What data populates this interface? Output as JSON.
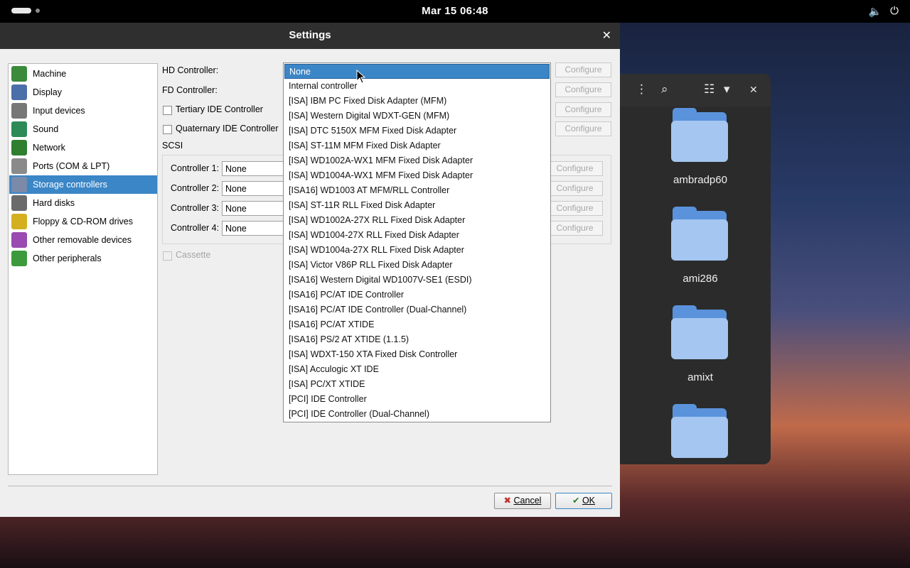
{
  "topbar": {
    "clock": "Mar 15  06:48",
    "volume_icon": "🔈",
    "power_icon": "⏻"
  },
  "files": {
    "header_icons": {
      "menu": "⋮",
      "search": "⌕",
      "view": "☷",
      "dropdown": "▾",
      "close": "✕"
    },
    "folders": [
      "ambradp60",
      "ami286",
      "amixt",
      ""
    ]
  },
  "dialog": {
    "title": "Settings",
    "close": "✕",
    "categories": [
      {
        "label": "Machine",
        "color": "#3c8a3c"
      },
      {
        "label": "Display",
        "color": "#4b6fa8"
      },
      {
        "label": "Input devices",
        "color": "#777777"
      },
      {
        "label": "Sound",
        "color": "#2e8b57"
      },
      {
        "label": "Network",
        "color": "#2f7f2f"
      },
      {
        "label": "Ports (COM & LPT)",
        "color": "#8a8a8a"
      },
      {
        "label": "Storage controllers",
        "color": "#7a8aa8"
      },
      {
        "label": "Hard disks",
        "color": "#6a6a6a"
      },
      {
        "label": "Floppy & CD-ROM drives",
        "color": "#d4b020"
      },
      {
        "label": "Other removable devices",
        "color": "#9a4ab0"
      },
      {
        "label": "Other peripherals",
        "color": "#3c9a3c"
      }
    ],
    "selected_category": "Storage controllers",
    "hd_controller_label": "HD Controller:",
    "fd_controller_label": "FD Controller:",
    "tertiary_label": "Tertiary IDE Controller",
    "quaternary_label": "Quaternary IDE Controller",
    "scsi_label": "SCSI",
    "scsi_controllers": [
      {
        "label": "Controller 1:",
        "value": "None"
      },
      {
        "label": "Controller 2:",
        "value": "None"
      },
      {
        "label": "Controller 3:",
        "value": "None"
      },
      {
        "label": "Controller 4:",
        "value": "None"
      }
    ],
    "cassette_label": "Cassette",
    "configure_label": "Configure",
    "cancel_label": "Cancel",
    "ok_label": "OK"
  },
  "dropdown": {
    "selected": "None",
    "options": [
      "None",
      "Internal controller",
      "[ISA] IBM PC Fixed Disk Adapter (MFM)",
      "[ISA] Western Digital WDXT-GEN (MFM)",
      "[ISA] DTC 5150X MFM Fixed Disk Adapter",
      "[ISA] ST-11M MFM Fixed Disk Adapter",
      "[ISA] WD1002A-WX1 MFM Fixed Disk Adapter",
      "[ISA] WD1004A-WX1 MFM Fixed Disk Adapter",
      "[ISA16] WD1003 AT MFM/RLL Controller",
      "[ISA] ST-11R RLL Fixed Disk Adapter",
      "[ISA] WD1002A-27X RLL Fixed Disk Adapter",
      "[ISA] WD1004-27X RLL Fixed Disk Adapter",
      "[ISA] WD1004a-27X RLL Fixed Disk Adapter",
      "[ISA] Victor V86P RLL Fixed Disk Adapter",
      "[ISA16] Western Digital WD1007V-SE1 (ESDI)",
      "[ISA16] PC/AT IDE Controller",
      "[ISA16] PC/AT IDE Controller (Dual-Channel)",
      "[ISA16] PC/AT XTIDE",
      "[ISA16] PS/2 AT XTIDE (1.1.5)",
      "[ISA] WDXT-150 XTA Fixed Disk Controller",
      "[ISA] Acculogic XT IDE",
      "[ISA] PC/XT XTIDE",
      "[PCI] IDE Controller",
      "[PCI] IDE Controller (Dual-Channel)"
    ]
  }
}
